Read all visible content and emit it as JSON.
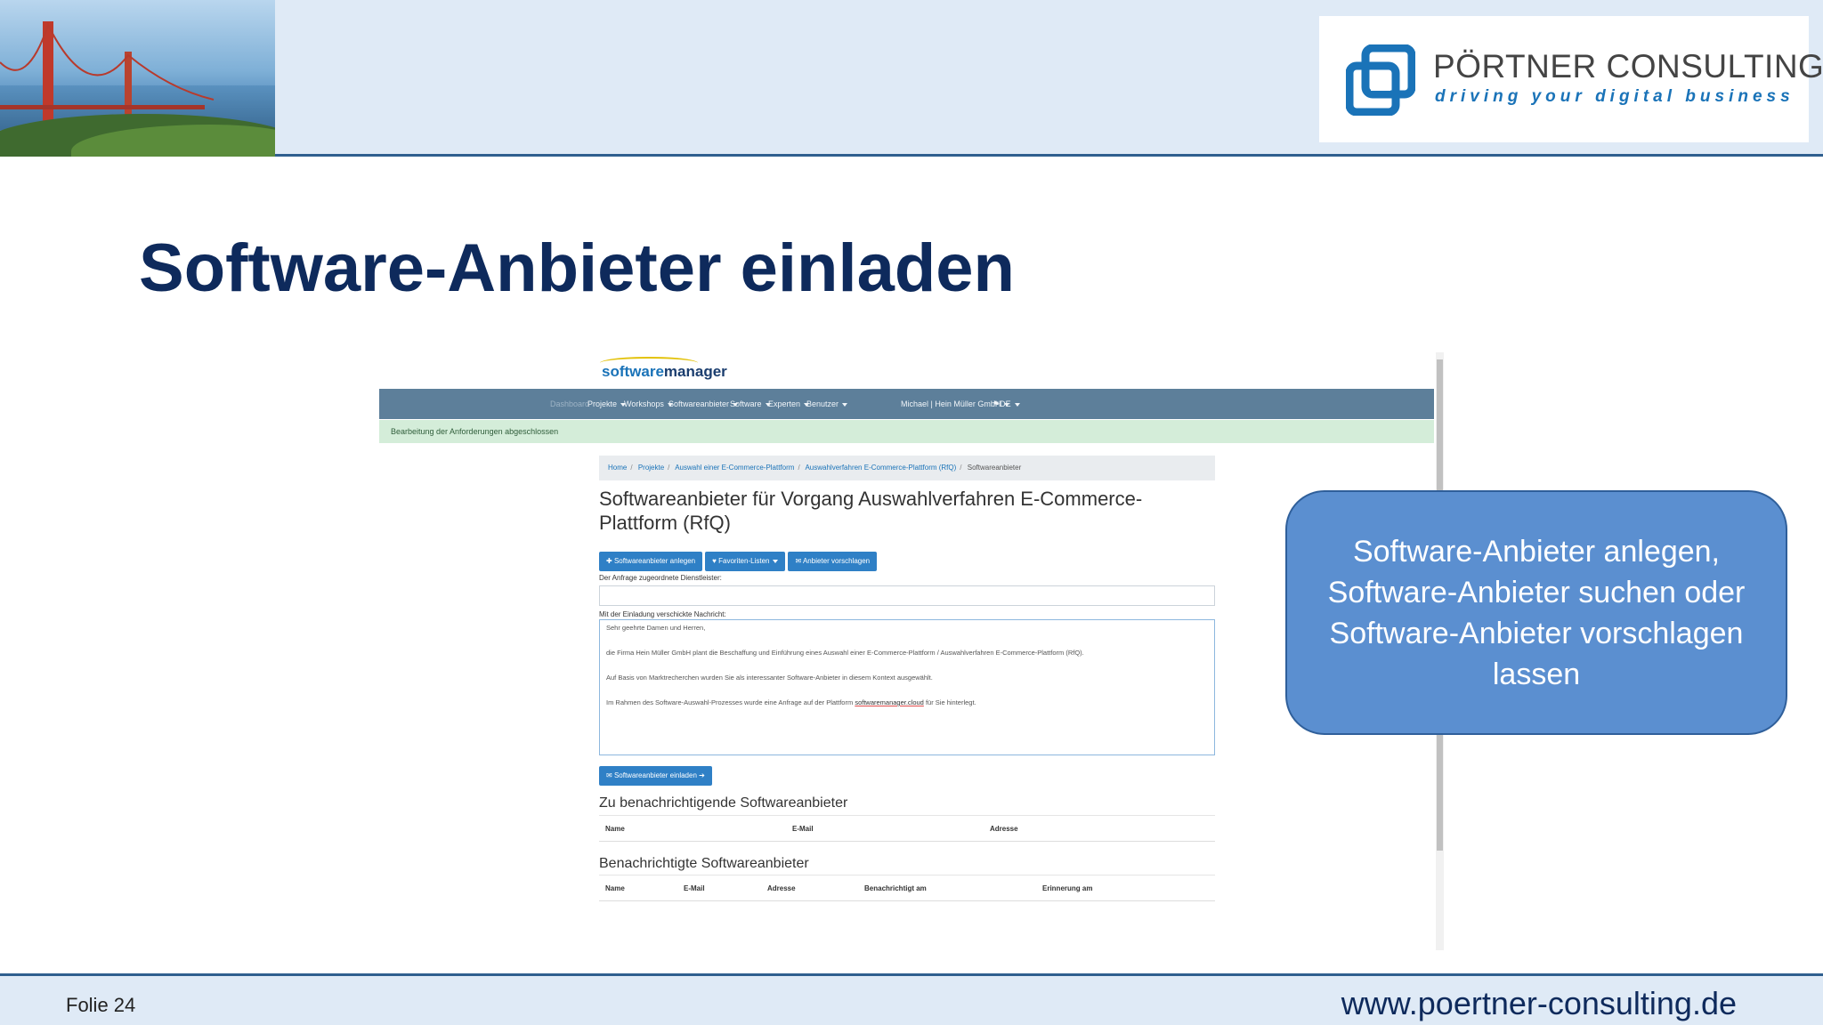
{
  "slide": {
    "title": "Software-Anbieter einladen",
    "footer_label": "Folie 24",
    "footer_url": "www.poertner-consulting.de",
    "callout": "Software-Anbieter anlegen,\nSoftware-Anbieter suchen oder\nSoftware-Anbieter vorschlagen\nlassen",
    "colors": {
      "title": "#0e2a5c",
      "callout_bg": "#5b8fd0",
      "header_bg": "#dfeaf6"
    }
  },
  "logo": {
    "name": "PÖRTNER CONSULTING",
    "tagline": "driving your digital business"
  },
  "app": {
    "brand_prefix": "software",
    "brand_suffix": "manager",
    "nav": {
      "dashboard": "Dashboard",
      "items": [
        "Projekte",
        "Workshops",
        "Softwareanbieter",
        "Software",
        "Experten",
        "Benutzer"
      ],
      "user": "Michael | Hein Müller GmbH",
      "lang": "DE"
    },
    "alert": "Bearbeitung der Anforderungen abgeschlossen",
    "breadcrumb": [
      "Home",
      "Projekte",
      "Auswahl einer E-Commerce-Plattform",
      "Auswahlverfahren E-Commerce-Plattform (RfQ)",
      "Softwareanbieter"
    ],
    "heading": "Softwareanbieter für Vorgang Auswahlverfahren E-Commerce-Plattform (RfQ)",
    "buttons": {
      "add": "Softwareanbieter anlegen",
      "favorites": "Favoriten-Listen",
      "suggest": "Anbieter vorschlagen",
      "invite": "Softwareanbieter einladen"
    },
    "label_provider": "Der Anfrage zugeordnete Dienstleister:",
    "label_message": "Mit der Einladung verschickte Nachricht:",
    "message": {
      "line1": "Sehr geehrte Damen und Herren,",
      "line2": "die Firma Hein Müller GmbH plant die Beschaffung und Einführung eines Auswahl einer E-Commerce-Plattform / Auswahlverfahren E-Commerce-Plattform (RfQ).",
      "line3": "Auf Basis von Marktrecherchen wurden Sie als interessanter Software-Anbieter in diesem Kontext ausgewählt.",
      "line4_pre": "Im Rahmen des Software-Auswahl-Prozesses wurde eine Anfrage auf der Plattform ",
      "line4_link": "softwaremanager.cloud",
      "line4_post": " für Sie hinterlegt."
    },
    "section_to_notify": "Zu benachrichtigende Softwareanbieter",
    "table_to_notify": [
      "Name",
      "E-Mail",
      "Adresse"
    ],
    "section_notified": "Benachrichtigte Softwareanbieter",
    "table_notified": [
      "Name",
      "E-Mail",
      "Adresse",
      "Benachrichtigt am",
      "Erinnerung am"
    ]
  }
}
